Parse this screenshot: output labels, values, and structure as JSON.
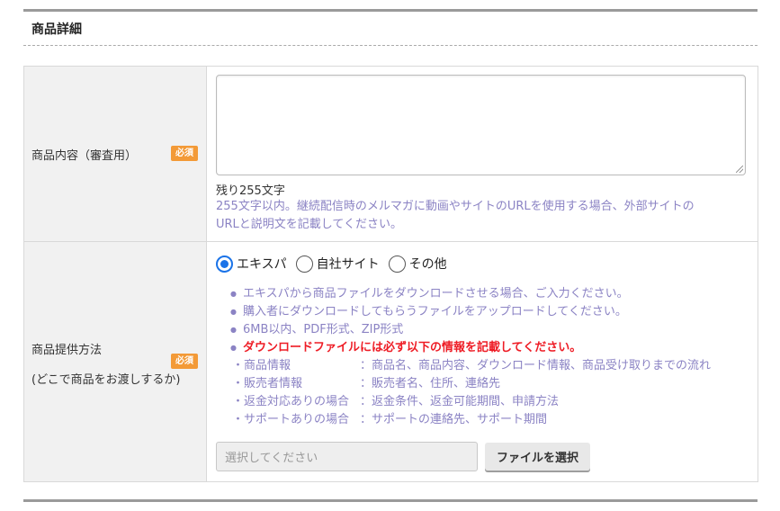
{
  "section": {
    "title": "商品詳細"
  },
  "row_description": {
    "label": "商品内容（審査用）",
    "required_badge": "必須",
    "textarea_value": "",
    "remaining": "残り255文字",
    "help_line1": "255文字以内。継続配信時のメルマガに動画やサイトのURLを使用する場合、外部サイトの",
    "help_line2": "URLと説明文を記載してください。"
  },
  "row_delivery": {
    "label_line1": "商品提供方法",
    "label_line2": "(どこで商品をお渡しするか)",
    "required_badge": "必須",
    "radios": [
      {
        "label": "エキスパ",
        "checked": true
      },
      {
        "label": "自社サイト",
        "checked": false
      },
      {
        "label": "その他",
        "checked": false
      }
    ],
    "notes": [
      "エキスパから商品ファイルをダウンロードさせる場合、ご入力ください。",
      "購入者にダウンロードしてもらうファイルをアップロードしてください。",
      "6MB以内、PDF形式、ZIP形式",
      "ダウンロードファイルには必ず以下の情報を記載してください。"
    ],
    "sub_items": [
      {
        "key": "・商品情報",
        "value": "：商品名、商品内容、ダウンロード情報、商品受け取りまでの流れ"
      },
      {
        "key": "・販売者情報",
        "value": "：販売者名、住所、連絡先"
      },
      {
        "key": "・返金対応ありの場合",
        "value": "：返金条件、返金可能期間、申請方法"
      },
      {
        "key": "・サポートありの場合",
        "value": "：サポートの連絡先、サポート期間"
      }
    ],
    "file_placeholder": "選択してください",
    "file_button": "ファイルを選択"
  },
  "colors": {
    "required_badge": "#f39a37",
    "help_text": "#8b83c4",
    "warning": "#ee1c25",
    "radio_accent": "#1a73e8"
  }
}
